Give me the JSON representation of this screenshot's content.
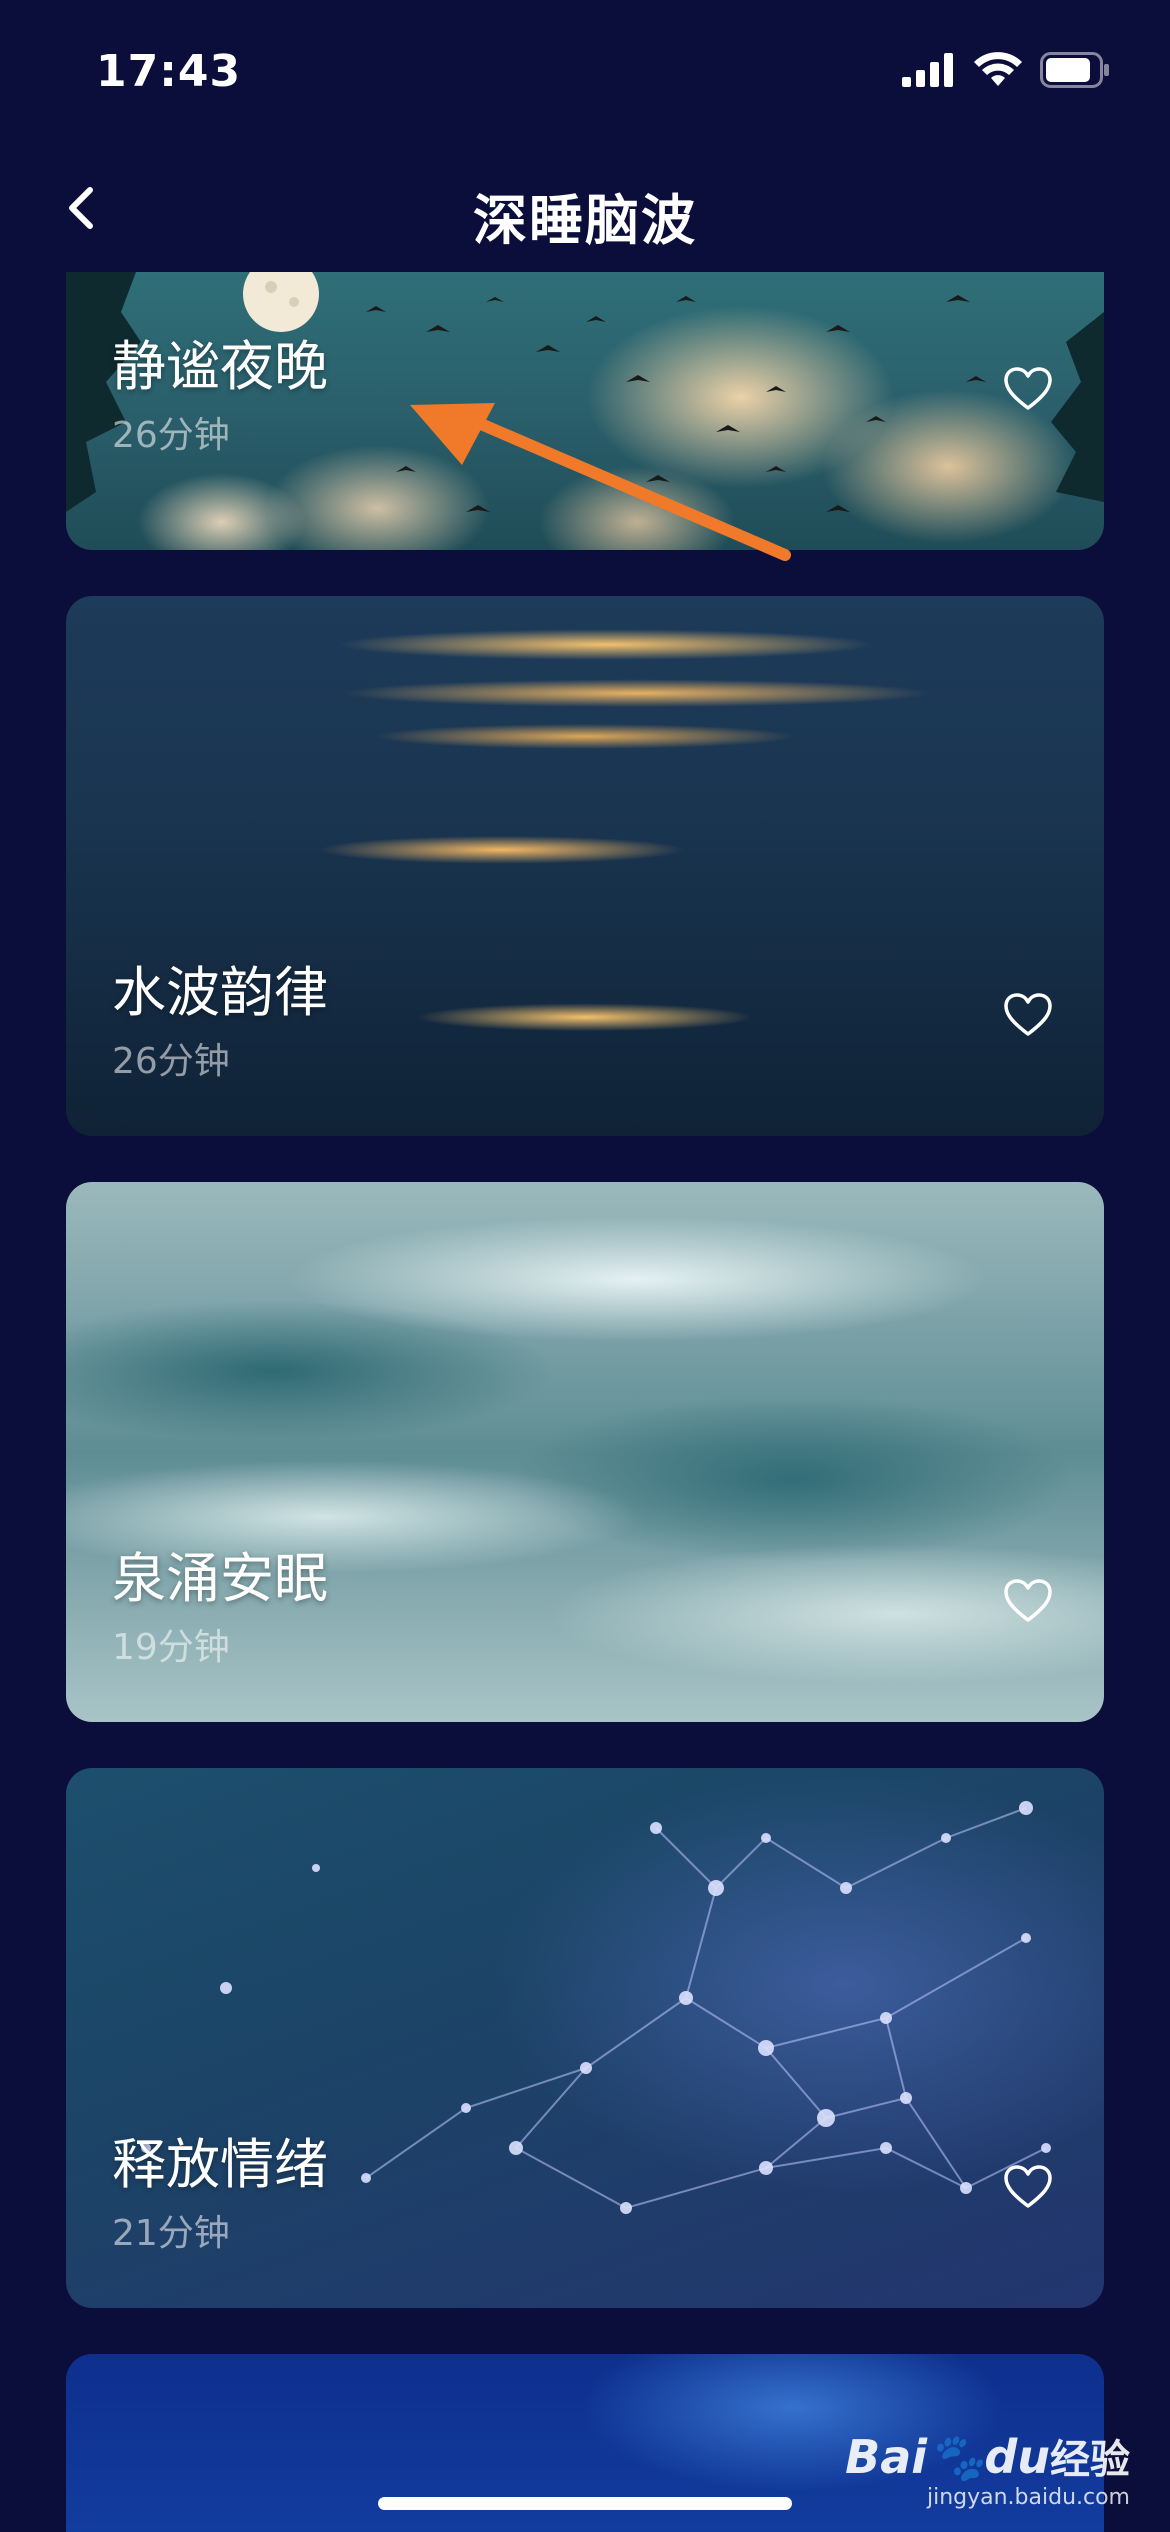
{
  "status_bar": {
    "time": "17:43"
  },
  "header": {
    "title": "深睡脑波",
    "back_icon": "chevron-left-icon"
  },
  "cards": [
    {
      "title": "静谧夜晚",
      "duration": "26分钟",
      "favorite_icon": "heart-outline-icon",
      "background": "night-sky-clouds-birds"
    },
    {
      "title": "水波韵律",
      "duration": "26分钟",
      "favorite_icon": "heart-outline-icon",
      "background": "golden-water-ripples"
    },
    {
      "title": "泉涌安眠",
      "duration": "19分钟",
      "favorite_icon": "heart-outline-icon",
      "background": "silver-liquid-waves"
    },
    {
      "title": "释放情绪",
      "duration": "21分钟",
      "favorite_icon": "heart-outline-icon",
      "background": "blue-network-nodes"
    }
  ],
  "watermark": {
    "logo_latin": "Bai",
    "logo_du": "du",
    "logo_cn": "经验",
    "url": "jingyan.baidu.com"
  },
  "colors": {
    "background": "#0b0d3a",
    "annotation_arrow": "#f07a2a",
    "heart_stroke": "#ffffff"
  }
}
